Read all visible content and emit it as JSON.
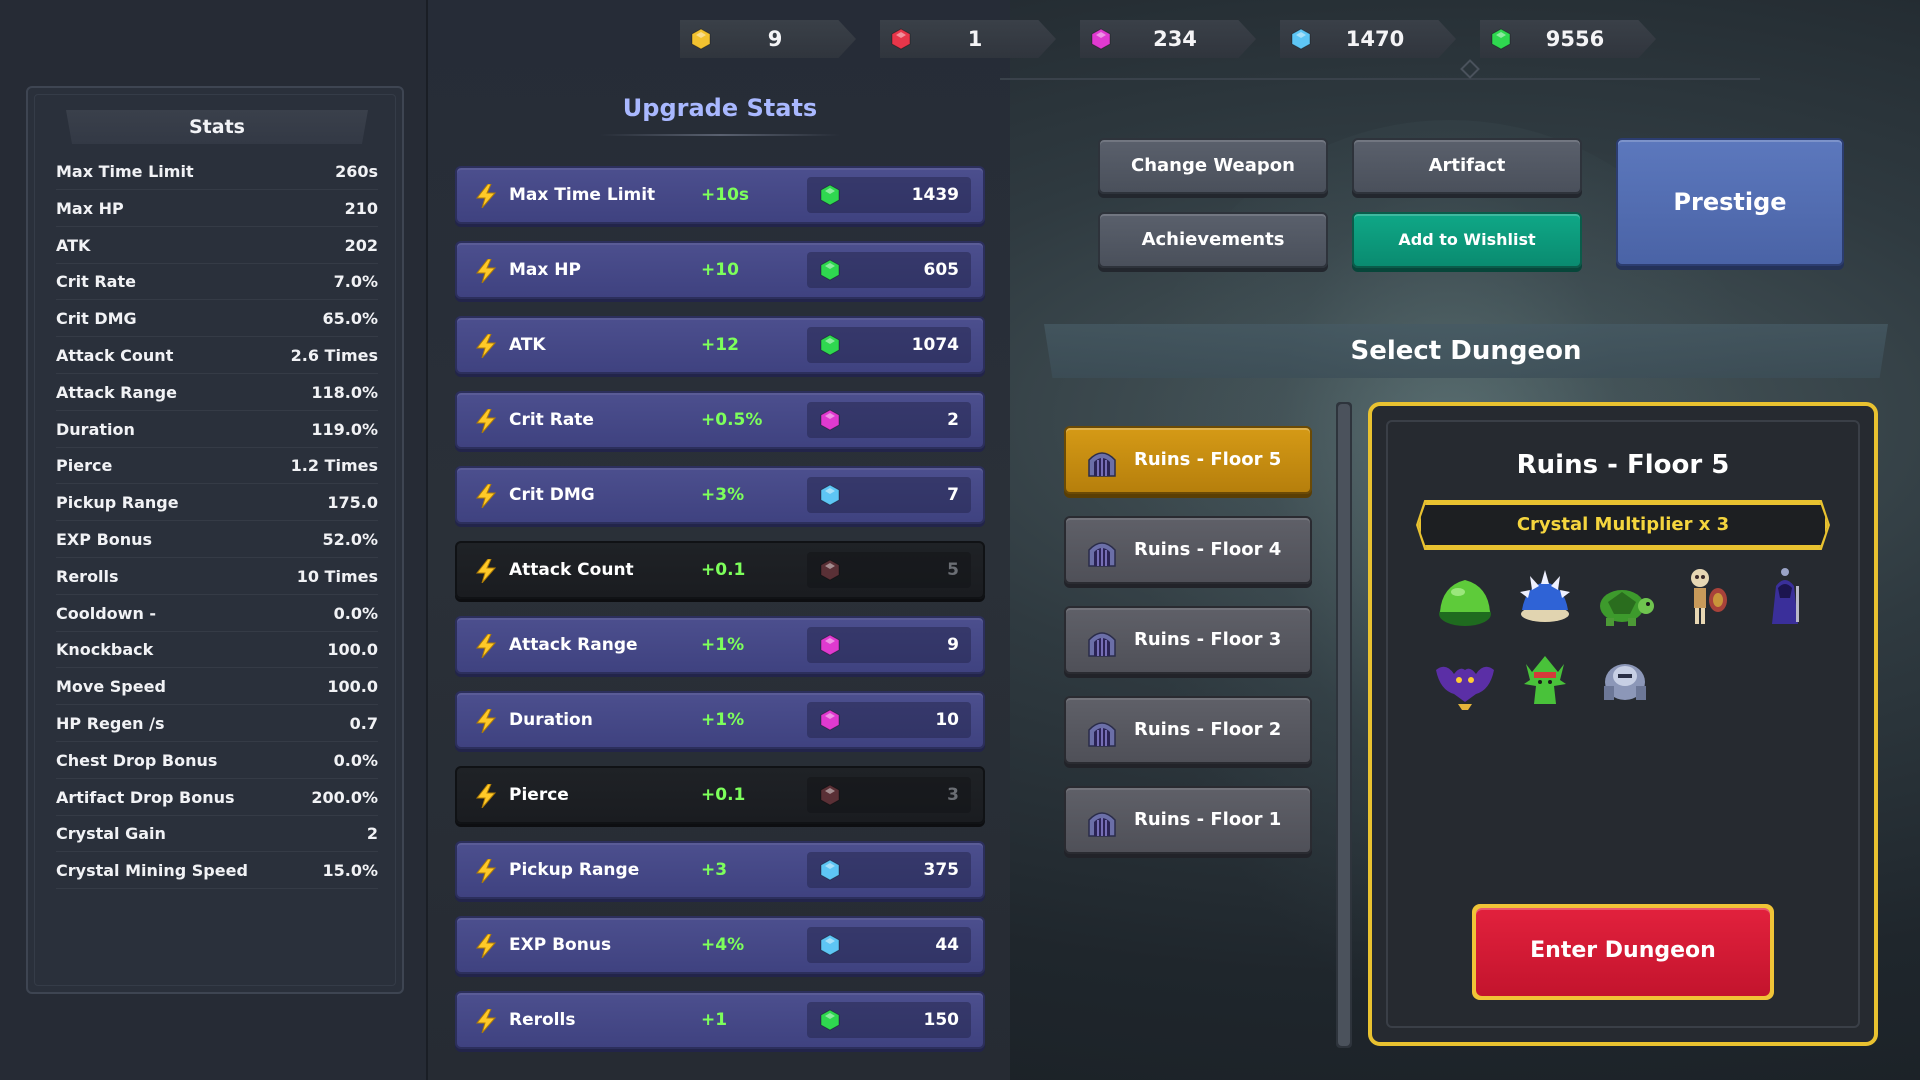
{
  "currencies": [
    {
      "icon": "yellow-gem-icon",
      "color": "#f2c230",
      "amount": "9"
    },
    {
      "icon": "red-gem-icon",
      "color": "#e8364a",
      "amount": "1"
    },
    {
      "icon": "magenta-gem-icon",
      "color": "#e03ad0",
      "amount": "234"
    },
    {
      "icon": "cyan-gem-icon",
      "color": "#5ec6f5",
      "amount": "1470"
    },
    {
      "icon": "green-gem-icon",
      "color": "#2fd850",
      "amount": "9556"
    }
  ],
  "stats": {
    "title": "Stats",
    "rows": [
      {
        "name": "Max Time Limit",
        "value": "260s"
      },
      {
        "name": "Max HP",
        "value": "210"
      },
      {
        "name": "ATK",
        "value": "202"
      },
      {
        "name": "Crit Rate",
        "value": "7.0%"
      },
      {
        "name": "Crit DMG",
        "value": "65.0%"
      },
      {
        "name": "Attack Count",
        "value": "2.6 Times"
      },
      {
        "name": "Attack Range",
        "value": "118.0%"
      },
      {
        "name": "Duration",
        "value": "119.0%"
      },
      {
        "name": "Pierce",
        "value": "1.2 Times"
      },
      {
        "name": "Pickup Range",
        "value": "175.0"
      },
      {
        "name": "EXP Bonus",
        "value": "52.0%"
      },
      {
        "name": "Rerolls",
        "value": "10 Times"
      },
      {
        "name": "Cooldown -",
        "value": "0.0%"
      },
      {
        "name": "Knockback",
        "value": "100.0"
      },
      {
        "name": "Move Speed",
        "value": "100.0"
      },
      {
        "name": "HP Regen /s",
        "value": "0.7"
      },
      {
        "name": "Chest Drop Bonus",
        "value": "0.0%"
      },
      {
        "name": "Artifact Drop Bonus",
        "value": "200.0%"
      },
      {
        "name": "Crystal Gain",
        "value": "2"
      },
      {
        "name": "Crystal Mining Speed",
        "value": "15.0%"
      }
    ]
  },
  "upgrade": {
    "title": "Upgrade Stats",
    "rows": [
      {
        "label": "Max Time Limit",
        "bonus": "+10s",
        "gem": "green-gem-icon",
        "color": "#2fd850",
        "cost": "1439",
        "locked": false
      },
      {
        "label": "Max HP",
        "bonus": "+10",
        "gem": "green-gem-icon",
        "color": "#2fd850",
        "cost": "605",
        "locked": false
      },
      {
        "label": "ATK",
        "bonus": "+12",
        "gem": "green-gem-icon",
        "color": "#2fd850",
        "cost": "1074",
        "locked": false
      },
      {
        "label": "Crit Rate",
        "bonus": "+0.5%",
        "gem": "magenta-gem-icon",
        "color": "#e03ad0",
        "cost": "2",
        "locked": false
      },
      {
        "label": "Crit DMG",
        "bonus": "+3%",
        "gem": "cyan-gem-icon",
        "color": "#5ec6f5",
        "cost": "7",
        "locked": false
      },
      {
        "label": "Attack Count",
        "bonus": "+0.1",
        "gem": "red-gem-icon",
        "color": "#5a3036",
        "cost": "5",
        "locked": true
      },
      {
        "label": "Attack Range",
        "bonus": "+1%",
        "gem": "magenta-gem-icon",
        "color": "#e03ad0",
        "cost": "9",
        "locked": false
      },
      {
        "label": "Duration",
        "bonus": "+1%",
        "gem": "magenta-gem-icon",
        "color": "#e03ad0",
        "cost": "10",
        "locked": false
      },
      {
        "label": "Pierce",
        "bonus": "+0.1",
        "gem": "red-gem-icon",
        "color": "#5a3036",
        "cost": "3",
        "locked": true
      },
      {
        "label": "Pickup Range",
        "bonus": "+3",
        "gem": "cyan-gem-icon",
        "color": "#5ec6f5",
        "cost": "375",
        "locked": false
      },
      {
        "label": "EXP Bonus",
        "bonus": "+4%",
        "gem": "cyan-gem-icon",
        "color": "#5ec6f5",
        "cost": "44",
        "locked": false
      },
      {
        "label": "Rerolls",
        "bonus": "+1",
        "gem": "green-gem-icon",
        "color": "#2fd850",
        "cost": "150",
        "locked": false
      }
    ]
  },
  "buttons": {
    "change_weapon": "Change Weapon",
    "artifact": "Artifact",
    "achievements": "Achievements",
    "add_to_wishlist": "Add to Wishlist",
    "prestige": "Prestige"
  },
  "dungeon": {
    "title": "Select Dungeon",
    "floors": [
      {
        "label": "Ruins - Floor 5",
        "selected": true
      },
      {
        "label": "Ruins - Floor 4",
        "selected": false
      },
      {
        "label": "Ruins - Floor 3",
        "selected": false
      },
      {
        "label": "Ruins - Floor 2",
        "selected": false
      },
      {
        "label": "Ruins - Floor 1",
        "selected": false
      }
    ],
    "detail": {
      "title": "Ruins - Floor 5",
      "multiplier": "Crystal Multiplier  x  3",
      "monsters": [
        "green-slime-icon",
        "blue-spiked-shell-icon",
        "green-turtle-icon",
        "skeleton-warrior-icon",
        "purple-hooded-mage-icon",
        "purple-bat-icon",
        "green-plant-creature-icon",
        "armored-knight-icon"
      ],
      "enter_label": "Enter Dungeon"
    }
  },
  "colors": {
    "accent_gold": "#e9c230",
    "upgrade_row": "#4c4f8e",
    "bonus_green": "#7dff5b",
    "enter_red": "#d81a36",
    "wishlist_teal": "#0fa887",
    "prestige_blue": "#5470b5"
  }
}
